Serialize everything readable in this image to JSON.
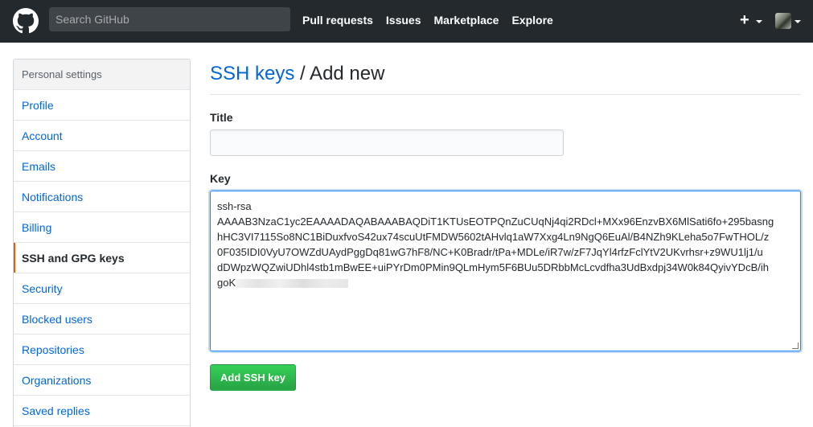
{
  "header": {
    "search_placeholder": "Search GitHub",
    "nav": [
      "Pull requests",
      "Issues",
      "Marketplace",
      "Explore"
    ],
    "plus_label": "+"
  },
  "sidebar": {
    "heading": "Personal settings",
    "items": [
      {
        "label": "Profile",
        "active": false
      },
      {
        "label": "Account",
        "active": false
      },
      {
        "label": "Emails",
        "active": false
      },
      {
        "label": "Notifications",
        "active": false
      },
      {
        "label": "Billing",
        "active": false
      },
      {
        "label": "SSH and GPG keys",
        "active": true
      },
      {
        "label": "Security",
        "active": false
      },
      {
        "label": "Blocked users",
        "active": false
      },
      {
        "label": "Repositories",
        "active": false
      },
      {
        "label": "Organizations",
        "active": false
      },
      {
        "label": "Saved replies",
        "active": false
      }
    ]
  },
  "main": {
    "title_link": "SSH keys",
    "title_rest": " / Add new",
    "title_label": "Title",
    "title_value": "",
    "key_label": "Key",
    "key_lines": [
      "ssh-rsa",
      "AAAAB3NzaC1yc2EAAAADAQABAAABAQDiT1KTUsEOTPQnZuCUqNj4qi2RDcl+MXx96EnzvBX6MlSati6fo+295basng",
      "hHC3VI7115So8NC1BiDuxfvoS42ux74scuUtFMDW5602tAHvlq1aW7Xxg4Ln9NgQ6EuAl/B4NZh9KLeha5o7FwTHOL/z",
      "0F035IDI0VyU7OWZdUAydPggDq81wG7hF8/NC+K0Bradr/tPa+MDLe/iR7w/zF7JqYl4rfzFclYtV2UKvrhsr+z9WU1lj1/u",
      "dDWpzWQZwiUDhl4stb1mBwEE+uiPYrDm0PMin9QLmHym5F6BUu5DRbbMcLcvdfha3UdBxdpj34W0k84QyivYDcB/ih",
      "goK"
    ],
    "submit_label": "Add SSH key"
  },
  "colors": {
    "header_bg": "#24292e",
    "link": "#0366d6",
    "active_marker": "#e36209",
    "button_green": "#28a745"
  }
}
